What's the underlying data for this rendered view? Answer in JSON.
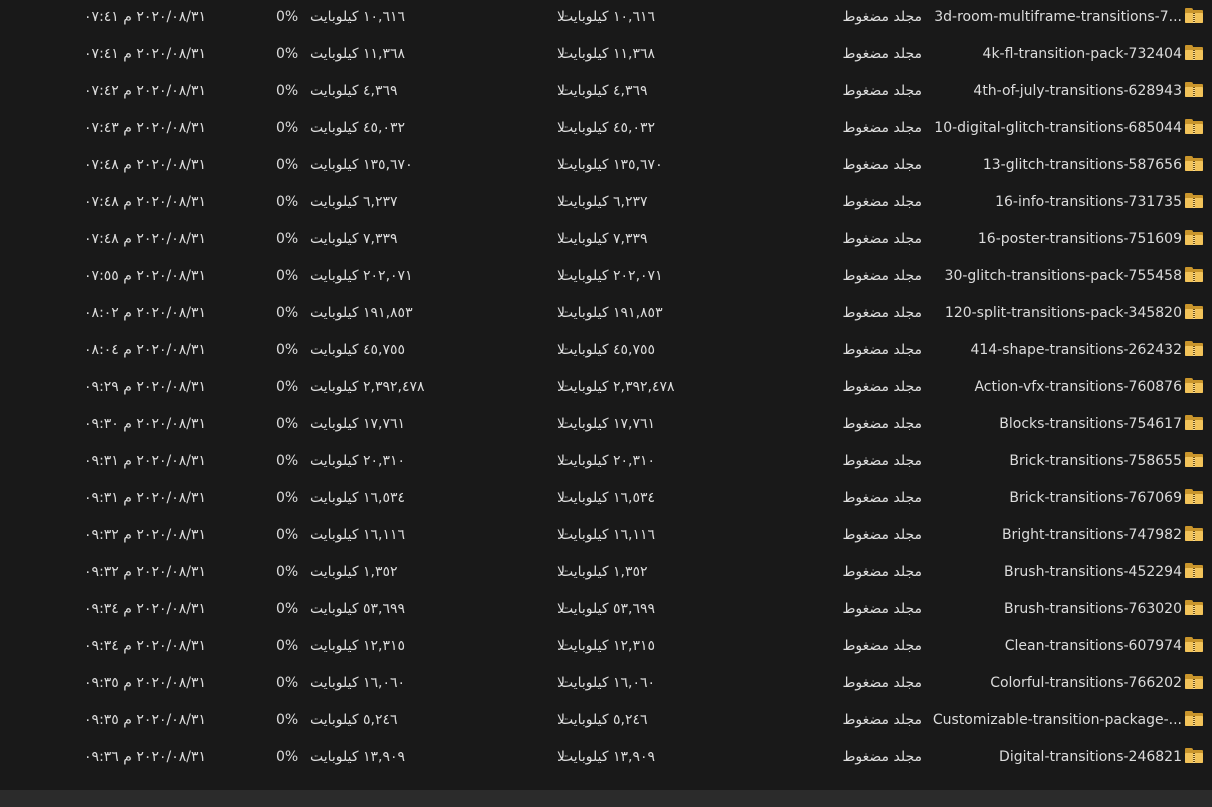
{
  "rows": [
    {
      "name": "3d-room-multiframe-transitions-7...",
      "type": "مجلد مضغوط",
      "compressed_size": "١٠,٦١٦ كيلوبايت",
      "encrypted": "لا",
      "size": "١٠,٦١٦ كيلوبايت",
      "ratio": "0%",
      "date": "٢٠٢٠/٠٨/٣١ م ٠٧:٤١"
    },
    {
      "name": "4k-fl-transition-pack-732404",
      "type": "مجلد مضغوط",
      "compressed_size": "١١,٣٦٨ كيلوبايت",
      "encrypted": "لا",
      "size": "١١,٣٦٨ كيلوبايت",
      "ratio": "0%",
      "date": "٢٠٢٠/٠٨/٣١ م ٠٧:٤١"
    },
    {
      "name": "4th-of-july-transitions-628943",
      "type": "مجلد مضغوط",
      "compressed_size": "٤,٣٦٩ كيلوبايت",
      "encrypted": "لا",
      "size": "٤,٣٦٩ كيلوبايت",
      "ratio": "0%",
      "date": "٢٠٢٠/٠٨/٣١ م ٠٧:٤٢"
    },
    {
      "name": "10-digital-glitch-transitions-685044",
      "type": "مجلد مضغوط",
      "compressed_size": "٤٥,٠٣٢ كيلوبايت",
      "encrypted": "لا",
      "size": "٤٥,٠٣٢ كيلوبايت",
      "ratio": "0%",
      "date": "٢٠٢٠/٠٨/٣١ م ٠٧:٤٣"
    },
    {
      "name": "13-glitch-transitions-587656",
      "type": "مجلد مضغوط",
      "compressed_size": "١٣٥,٦٧٠ كيلوبايت",
      "encrypted": "لا",
      "size": "١٣٥,٦٧٠ كيلوبايت",
      "ratio": "0%",
      "date": "٢٠٢٠/٠٨/٣١ م ٠٧:٤٨"
    },
    {
      "name": "16-info-transitions-731735",
      "type": "مجلد مضغوط",
      "compressed_size": "٦,٢٣٧ كيلوبايت",
      "encrypted": "لا",
      "size": "٦,٢٣٧ كيلوبايت",
      "ratio": "0%",
      "date": "٢٠٢٠/٠٨/٣١ م ٠٧:٤٨"
    },
    {
      "name": "16-poster-transitions-751609",
      "type": "مجلد مضغوط",
      "compressed_size": "٧,٣٣٩ كيلوبايت",
      "encrypted": "لا",
      "size": "٧,٣٣٩ كيلوبايت",
      "ratio": "0%",
      "date": "٢٠٢٠/٠٨/٣١ م ٠٧:٤٨"
    },
    {
      "name": "30-glitch-transitions-pack-755458",
      "type": "مجلد مضغوط",
      "compressed_size": "٢٠٢,٠٧١ كيلوبايت",
      "encrypted": "لا",
      "size": "٢٠٢,٠٧١ كيلوبايت",
      "ratio": "0%",
      "date": "٢٠٢٠/٠٨/٣١ م ٠٧:٥٥"
    },
    {
      "name": "120-split-transitions-pack-345820",
      "type": "مجلد مضغوط",
      "compressed_size": "١٩١,٨٥٣ كيلوبايت",
      "encrypted": "لا",
      "size": "١٩١,٨٥٣ كيلوبايت",
      "ratio": "0%",
      "date": "٢٠٢٠/٠٨/٣١ م ٠٨:٠٢"
    },
    {
      "name": "414-shape-transitions-262432",
      "type": "مجلد مضغوط",
      "compressed_size": "٤٥,٧٥٥ كيلوبايت",
      "encrypted": "لا",
      "size": "٤٥,٧٥٥ كيلوبايت",
      "ratio": "0%",
      "date": "٢٠٢٠/٠٨/٣١ م ٠٨:٠٤"
    },
    {
      "name": "Action-vfx-transitions-760876",
      "type": "مجلد مضغوط",
      "compressed_size": "٢,٣٩٢,٤٧٨ كيلوبايت",
      "encrypted": "لا",
      "size": "٢,٣٩٢,٤٧٨ كيلوبايت",
      "ratio": "0%",
      "date": "٢٠٢٠/٠٨/٣١ م ٠٩:٢٩"
    },
    {
      "name": "Blocks-transitions-754617",
      "type": "مجلد مضغوط",
      "compressed_size": "١٧,٧٦١ كيلوبايت",
      "encrypted": "لا",
      "size": "١٧,٧٦١ كيلوبايت",
      "ratio": "0%",
      "date": "٢٠٢٠/٠٨/٣١ م ٠٩:٣٠"
    },
    {
      "name": "Brick-transitions-758655",
      "type": "مجلد مضغوط",
      "compressed_size": "٢٠,٣١٠ كيلوبايت",
      "encrypted": "لا",
      "size": "٢٠,٣١٠ كيلوبايت",
      "ratio": "0%",
      "date": "٢٠٢٠/٠٨/٣١ م ٠٩:٣١"
    },
    {
      "name": "Brick-transitions-767069",
      "type": "مجلد مضغوط",
      "compressed_size": "١٦,٥٣٤ كيلوبايت",
      "encrypted": "لا",
      "size": "١٦,٥٣٤ كيلوبايت",
      "ratio": "0%",
      "date": "٢٠٢٠/٠٨/٣١ م ٠٩:٣١"
    },
    {
      "name": "Bright-transitions-747982",
      "type": "مجلد مضغوط",
      "compressed_size": "١٦,١١٦ كيلوبايت",
      "encrypted": "لا",
      "size": "١٦,١١٦ كيلوبايت",
      "ratio": "0%",
      "date": "٢٠٢٠/٠٨/٣١ م ٠٩:٣٢"
    },
    {
      "name": "Brush-transitions-452294",
      "type": "مجلد مضغوط",
      "compressed_size": "١,٣٥٢ كيلوبايت",
      "encrypted": "لا",
      "size": "١,٣٥٢ كيلوبايت",
      "ratio": "0%",
      "date": "٢٠٢٠/٠٨/٣١ م ٠٩:٣٢"
    },
    {
      "name": "Brush-transitions-763020",
      "type": "مجلد مضغوط",
      "compressed_size": "٥٣,٦٩٩ كيلوبايت",
      "encrypted": "لا",
      "size": "٥٣,٦٩٩ كيلوبايت",
      "ratio": "0%",
      "date": "٢٠٢٠/٠٨/٣١ م ٠٩:٣٤"
    },
    {
      "name": "Clean-transitions-607974",
      "type": "مجلد مضغوط",
      "compressed_size": "١٢,٣١٥ كيلوبايت",
      "encrypted": "لا",
      "size": "١٢,٣١٥ كيلوبايت",
      "ratio": "0%",
      "date": "٢٠٢٠/٠٨/٣١ م ٠٩:٣٤"
    },
    {
      "name": "Colorful-transitions-766202",
      "type": "مجلد مضغوط",
      "compressed_size": "١٦,٠٦٠ كيلوبايت",
      "encrypted": "لا",
      "size": "١٦,٠٦٠ كيلوبايت",
      "ratio": "0%",
      "date": "٢٠٢٠/٠٨/٣١ م ٠٩:٣٥"
    },
    {
      "name": "Customizable-transition-package-...",
      "type": "مجلد مضغوط",
      "compressed_size": "٥,٢٤٦ كيلوبايت",
      "encrypted": "لا",
      "size": "٥,٢٤٦ كيلوبايت",
      "ratio": "0%",
      "date": "٢٠٢٠/٠٨/٣١ م ٠٩:٣٥"
    },
    {
      "name": "Digital-transitions-246821",
      "type": "مجلد مضغوط",
      "compressed_size": "١٣,٩٠٩ كيلوبايت",
      "encrypted": "لا",
      "size": "١٣,٩٠٩ كيلوبايت",
      "ratio": "0%",
      "date": "٢٠٢٠/٠٨/٣١ م ٠٩:٣٦"
    }
  ],
  "icon": "zip-folder-icon"
}
